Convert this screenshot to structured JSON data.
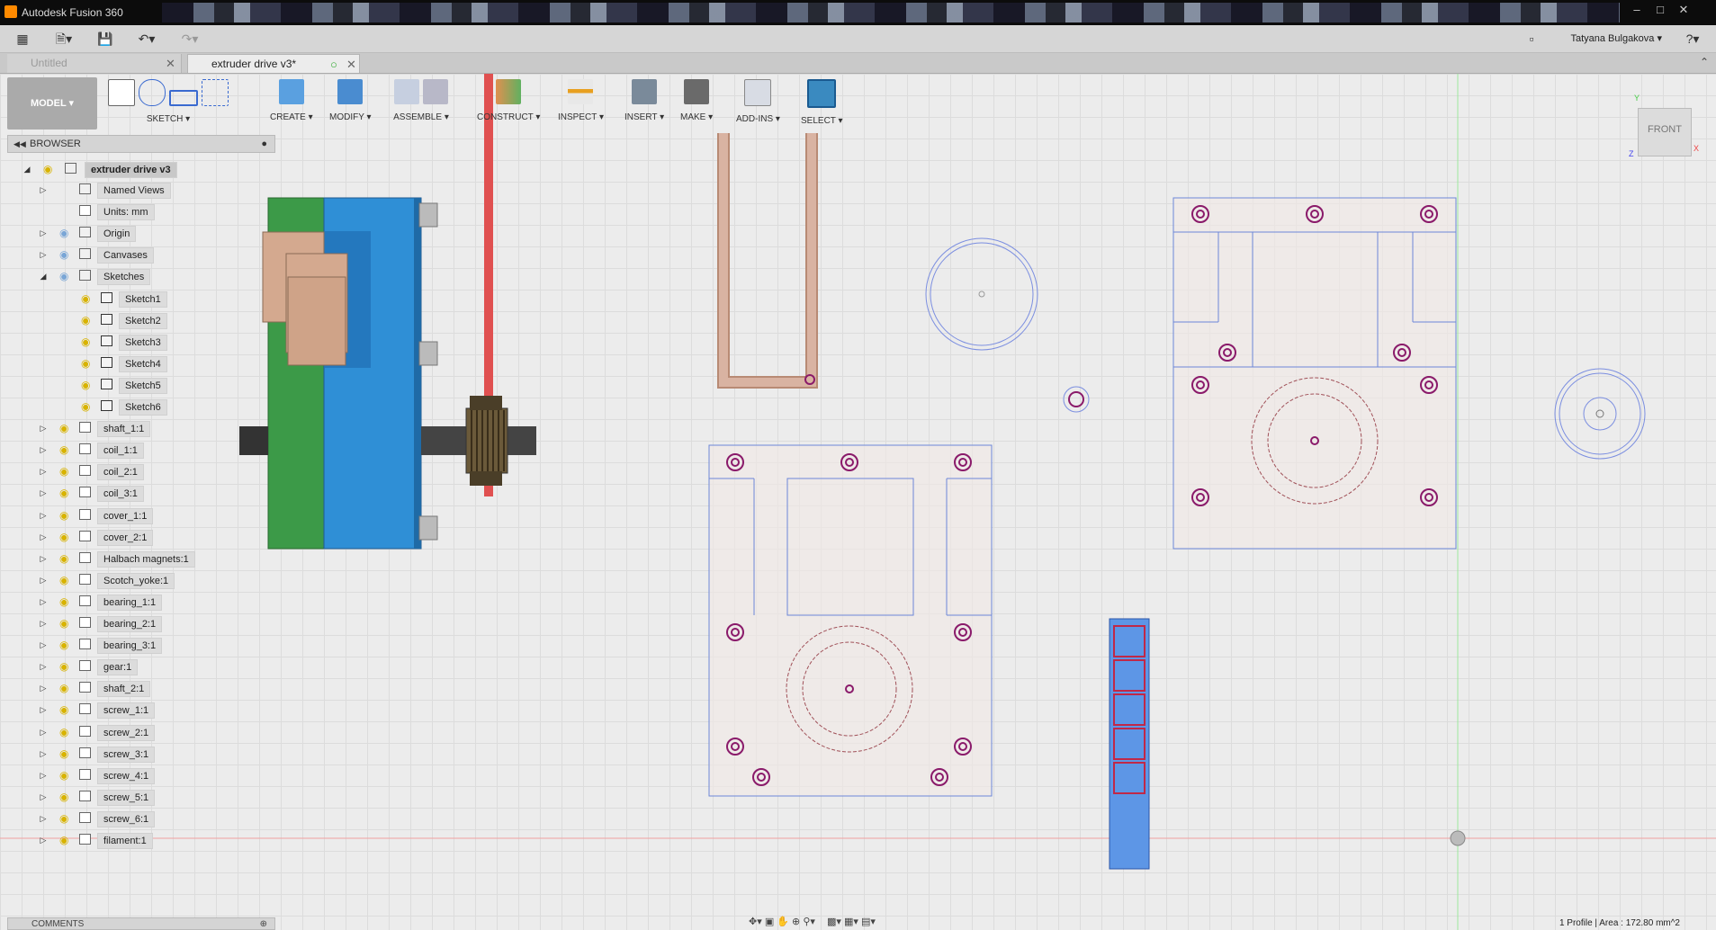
{
  "window": {
    "title": "Autodesk Fusion 360"
  },
  "quick_access": {
    "user_name": "Tatyana Bulgakova",
    "help": "?"
  },
  "tabs": [
    {
      "label": "Untitled",
      "active": false
    },
    {
      "label": "extruder drive v3*",
      "active": true
    }
  ],
  "ribbon": {
    "workspace": "MODEL",
    "groups": [
      "SKETCH",
      "CREATE",
      "MODIFY",
      "ASSEMBLE",
      "CONSTRUCT",
      "INSPECT",
      "INSERT",
      "MAKE",
      "ADD-INS",
      "SELECT"
    ]
  },
  "browser": {
    "title": "BROWSER",
    "root": "extruder drive v3",
    "items": [
      {
        "label": "Named Views",
        "type": "folder"
      },
      {
        "label": "Units: mm",
        "type": "units"
      },
      {
        "label": "Origin",
        "type": "folder"
      },
      {
        "label": "Canvases",
        "type": "folder"
      },
      {
        "label": "Sketches",
        "type": "folder",
        "expanded": true
      },
      {
        "label": "Sketch1",
        "type": "sketch"
      },
      {
        "label": "Sketch2",
        "type": "sketch"
      },
      {
        "label": "Sketch3",
        "type": "sketch"
      },
      {
        "label": "Sketch4",
        "type": "sketch"
      },
      {
        "label": "Sketch5",
        "type": "sketch"
      },
      {
        "label": "Sketch6",
        "type": "sketch"
      },
      {
        "label": "shaft_1:1",
        "type": "component"
      },
      {
        "label": "coil_1:1",
        "type": "component"
      },
      {
        "label": "coil_2:1",
        "type": "component"
      },
      {
        "label": "coil_3:1",
        "type": "component"
      },
      {
        "label": "cover_1:1",
        "type": "component"
      },
      {
        "label": "cover_2:1",
        "type": "component"
      },
      {
        "label": "Halbach magnets:1",
        "type": "component"
      },
      {
        "label": "Scotch_yoke:1",
        "type": "component"
      },
      {
        "label": "bearing_1:1",
        "type": "component"
      },
      {
        "label": "bearing_2:1",
        "type": "component"
      },
      {
        "label": "bearing_3:1",
        "type": "component"
      },
      {
        "label": "gear:1",
        "type": "component"
      },
      {
        "label": "shaft_2:1",
        "type": "component"
      },
      {
        "label": "screw_1:1",
        "type": "component"
      },
      {
        "label": "screw_2:1",
        "type": "component"
      },
      {
        "label": "screw_3:1",
        "type": "component"
      },
      {
        "label": "screw_4:1",
        "type": "component"
      },
      {
        "label": "screw_5:1",
        "type": "component"
      },
      {
        "label": "screw_6:1",
        "type": "component"
      },
      {
        "label": "filament:1",
        "type": "component"
      }
    ]
  },
  "viewcube": {
    "face": "FRONT",
    "axis_x": "X",
    "axis_y": "Y",
    "axis_z": "Z"
  },
  "comments": {
    "title": "COMMENTS"
  },
  "status": {
    "text": "1 Profile | Area : 172.80 mm^2"
  },
  "colors": {
    "accent": "#2f8fd6",
    "sketch_line": "#3a5ecf",
    "constraint": "#8a1a6a",
    "axis_red": "#e04040",
    "axis_green": "#40c040"
  }
}
